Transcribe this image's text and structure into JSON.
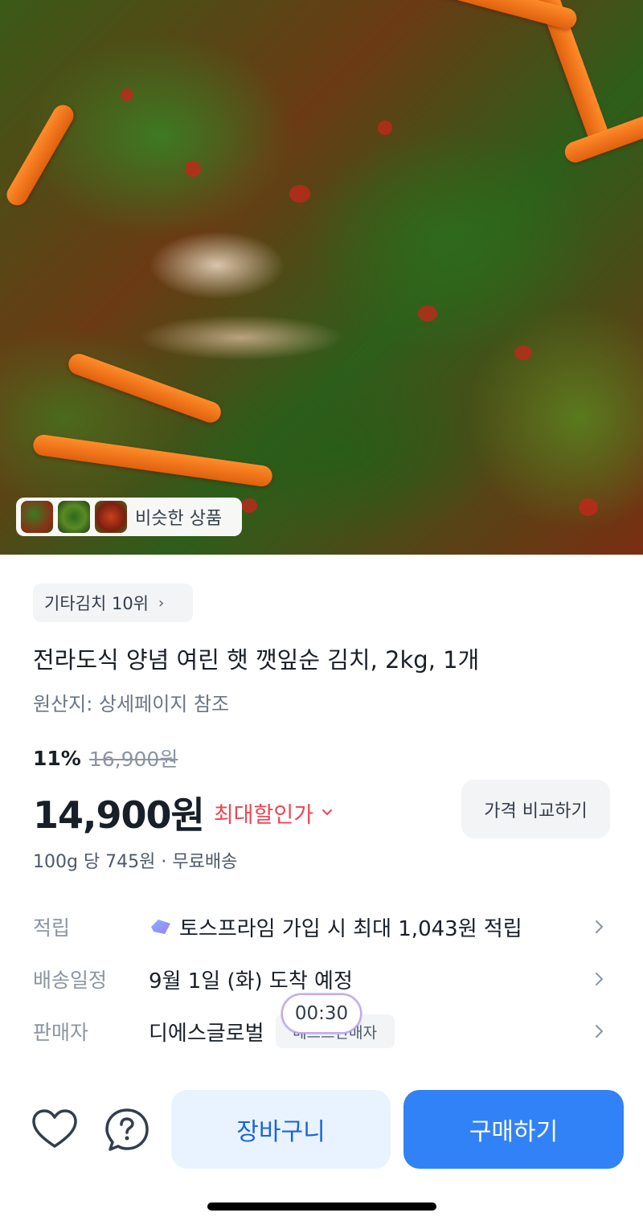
{
  "hero": {
    "similar_products_label": "비슷한 상품"
  },
  "product": {
    "rank_badge": "기타김치 10위",
    "title": "전라도식 양념 여린 햇 깻잎순 김치, 2kg, 1개",
    "origin": "원산지: 상세페이지 참조",
    "discount_rate": "11%",
    "original_price": "16,900원",
    "price": "14,900원",
    "max_discount_label": "최대할인가",
    "compare_button": "가격 비교하기",
    "unit_price_shipping": "100g 당 745원 · 무료배송"
  },
  "info_rows": {
    "reward": {
      "label": "적립",
      "value": "토스프라임 가입 시 최대 1,043원 적립"
    },
    "delivery": {
      "label": "배송일정",
      "value": "9월 1일 (화) 도착 예정"
    },
    "seller": {
      "label": "판매자",
      "value": "디에스글로벌",
      "badge": "베스트판매자"
    }
  },
  "timer": "00:30",
  "bottom_bar": {
    "cart_label": "장바구니",
    "buy_label": "구매하기"
  },
  "colors": {
    "primary_blue": "#3182f6",
    "light_blue": "#e8f3ff",
    "discount_red": "#f04452",
    "text_dark": "#191f28",
    "text_gray": "#8b95a1"
  }
}
